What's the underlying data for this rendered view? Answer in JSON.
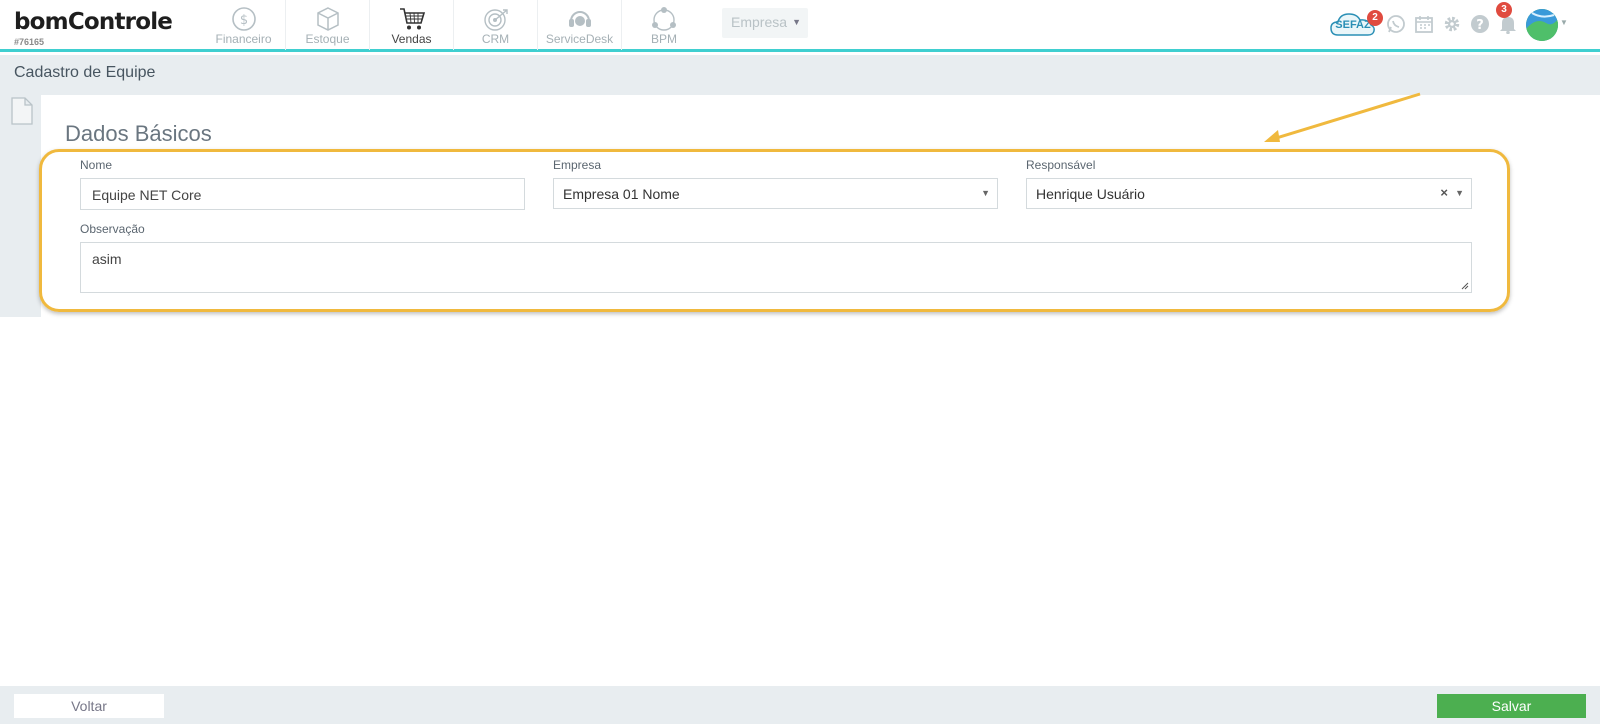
{
  "brand": {
    "logo_text": "bomControle",
    "account_id": "#76165"
  },
  "nav": {
    "modules": [
      {
        "label": "Financeiro",
        "icon": "dollar-coin-icon"
      },
      {
        "label": "Estoque",
        "icon": "box-icon"
      },
      {
        "label": "Vendas",
        "icon": "shopping-cart-icon"
      },
      {
        "label": "CRM",
        "icon": "target-icon"
      },
      {
        "label": "ServiceDesk",
        "icon": "headset-icon"
      },
      {
        "label": "BPM",
        "icon": "process-circle-icon"
      }
    ],
    "active_module": "Vendas",
    "empresa_select": "Empresa"
  },
  "header_icons": {
    "sefaz_label": "SEFAZ",
    "sefaz_badge": "2",
    "notifications_badge": "3"
  },
  "page": {
    "title": "Cadastro de Equipe"
  },
  "form": {
    "section_title": "Dados Básicos",
    "nome": {
      "label": "Nome",
      "value": "Equipe NET Core"
    },
    "empresa": {
      "label": "Empresa",
      "value": "Empresa 01 Nome"
    },
    "responsavel": {
      "label": "Responsável",
      "value": "Henrique Usuário"
    },
    "observacao": {
      "label": "Observação",
      "value": "asim"
    }
  },
  "footer": {
    "voltar_label": "Voltar",
    "salvar_label": "Salvar"
  },
  "colors": {
    "accent": "#3fcfd0",
    "highlight": "#f0b93e",
    "save": "#4caf50",
    "badge": "#e04b3f"
  }
}
